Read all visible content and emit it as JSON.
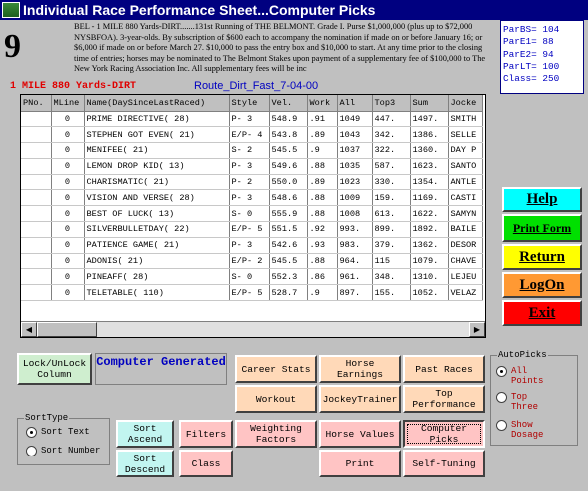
{
  "window": {
    "title": "Individual Race Performance Sheet...Computer Picks"
  },
  "race": {
    "number": "9",
    "description": "BEL - 1 MILE 880 Yards-DIRT.......131st Running of THE BELMONT. Grade I. Purse $1,000,000 (plus up to $72,000 NYSBFOA). 3-year-olds. By subscription of $600 each to accompany the nomination if made on or before January 16; or $6,000 if made on or before March 27. $10,000 to pass the entry box and $10,000 to start. At any time prior to the closing time of entries; horses may be nominated to The Belmont Stakes upon payment of a supplementary fee of $100,000 to The New York Racing Association Inc. All supplementary fees will be inc",
    "title": "1 MILE 880 Yards-DIRT",
    "route": "Route_Dirt_Fast_7-04-00"
  },
  "pars": [
    {
      "label": "ParBS=",
      "value": "104"
    },
    {
      "label": "ParE1=",
      "value": "88"
    },
    {
      "label": "ParE2=",
      "value": "94"
    },
    {
      "label": "ParLT=",
      "value": "100"
    },
    {
      "label": "Class=",
      "value": "250"
    }
  ],
  "grid": {
    "columns": [
      "PNo.",
      "MLine",
      "Name(DaySinceLastRaced)",
      "Style",
      "Vel.",
      "Work",
      "All",
      "Top3",
      "Sum",
      "Jocke"
    ],
    "rows": [
      [
        "",
        "0",
        "PRIME DIRECTIVE( 28)",
        "P- 3",
        "548.9",
        ".91",
        "1049",
        "447.",
        "1497.",
        "SMITH"
      ],
      [
        "",
        "0",
        "STEPHEN GOT EVEN( 21)",
        "E/P- 4",
        "543.8",
        ".89",
        "1043",
        "342.",
        "1386.",
        "SELLE"
      ],
      [
        "",
        "0",
        "MENIFEE( 21)",
        "S- 2",
        "545.5",
        ".9",
        "1037",
        "322.",
        "1360.",
        "DAY P"
      ],
      [
        "",
        "0",
        "LEMON DROP KID( 13)",
        "P- 3",
        "549.6",
        ".88",
        "1035",
        "587.",
        "1623.",
        "SANTO"
      ],
      [
        "",
        "0",
        "CHARISMATIC( 21)",
        "P- 2",
        "550.0",
        ".89",
        "1023",
        "330.",
        "1354.",
        "ANTLE"
      ],
      [
        "",
        "0",
        "VISION AND VERSE( 28)",
        "P- 3",
        "548.6",
        ".88",
        "1009",
        "159.",
        "1169.",
        "CASTI"
      ],
      [
        "",
        "0",
        "BEST OF LUCK( 13)",
        "S- 0",
        "555.9",
        ".88",
        "1008",
        "613.",
        "1622.",
        "SAMYN"
      ],
      [
        "",
        "0",
        "SILVERBULLETDAY( 22)",
        "E/P- 5",
        "551.5",
        ".92",
        "993.",
        "899.",
        "1892.",
        "BAILE"
      ],
      [
        "",
        "0",
        "PATIENCE GAME( 21)",
        "P- 3",
        "542.6",
        ".93",
        "983.",
        "379.",
        "1362.",
        "DESOR"
      ],
      [
        "",
        "0",
        "ADONIS( 21)",
        "E/P- 2",
        "545.5",
        ".88",
        "964.",
        "115",
        "1079.",
        "CHAVE"
      ],
      [
        "",
        "0",
        "PINEAFF( 28)",
        "S- 0",
        "552.3",
        ".86",
        "961.",
        "348.",
        "1310.",
        "LEJEU"
      ],
      [
        "",
        "0",
        "TELETABLE( 110)",
        "E/P- 5",
        "528.7",
        ".9",
        "897.",
        "155.",
        "1052.",
        "VELAZ"
      ]
    ]
  },
  "side_buttons": {
    "help": "Help",
    "print_form": "Print Form",
    "return": "Return",
    "logon": "LogOn",
    "exit": "Exit"
  },
  "controls": {
    "lock_unlock": "Lock/UnLock Column",
    "computer_generated": "Computer Generated",
    "career_stats": "Career Stats",
    "horse_earnings": "Horse Earnings",
    "past_races": "Past Races",
    "workout": "Workout",
    "jockey_trainer": "JockeyTrainer",
    "top_performance": "Top Performance",
    "filters": "Filters",
    "weighting_factors": "Weighting Factors",
    "horse_values": "Horse Values",
    "computer_picks": "Computer Picks",
    "class": "Class",
    "print": "Print",
    "self_tuning": "Self-Tuning",
    "sort_ascend": "Sort Ascend",
    "sort_descend": "Sort Descend"
  },
  "sort_type": {
    "legend": "SortType",
    "options": [
      "Sort Text",
      "Sort Number"
    ],
    "selected": 0
  },
  "autopicks": {
    "legend": "AutoPicks",
    "options": [
      "All Points",
      "Top Three",
      "Show Dosage"
    ],
    "selected": 0
  },
  "colors": {
    "title_bar": "#000080",
    "help": "#00ffff",
    "print_form": "#00e000",
    "return": "#ffff00",
    "logon": "#ff9933",
    "exit": "#ff0000"
  }
}
